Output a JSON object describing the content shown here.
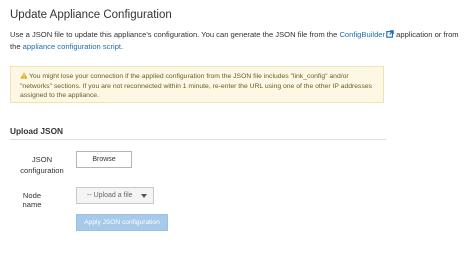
{
  "page": {
    "title": "Update Appliance Configuration"
  },
  "intro": {
    "part1": "Use a JSON file to update this appliance's configuration. You can generate the JSON file from the ",
    "configbuilder_link": "ConfigBuilder",
    "part2": " application or from the ",
    "script_link": "appliance configuration script",
    "part3": "."
  },
  "warning": {
    "text": "You might lose your connection if the applied configuration from the JSON file includes \"link_config\" and/or \"networks\" sections. If you are not reconnected within 1 minute, re-enter the URL using one of the other IP addresses assigned to the appliance."
  },
  "upload": {
    "section_title": "Upload JSON",
    "json_label": "JSON configuration",
    "browse_label": "Browse",
    "node_label": "Node name",
    "node_selected": "-- Upload a file",
    "apply_label": "Apply JSON configuration"
  },
  "colors": {
    "link": "#1a6fb3",
    "warning_bg": "#fcf8e3",
    "warning_icon": "#e6a51c",
    "apply_disabled": "#a7c9ea"
  }
}
